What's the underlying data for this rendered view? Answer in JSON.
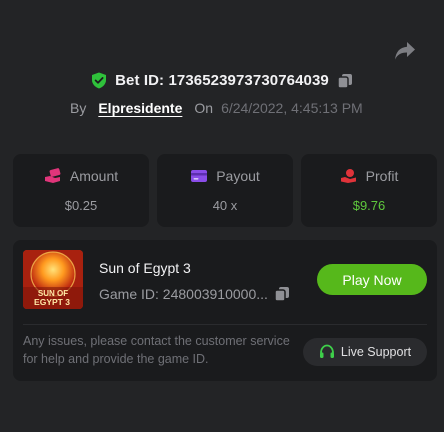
{
  "bet": {
    "id_prefix": "Bet ID:",
    "id_value": "1736523973730764039",
    "by_label": "By",
    "username": "Elpresidente",
    "on_label": "On",
    "date": "6/24/2022, 4:45:13 PM"
  },
  "stats": [
    {
      "label": "Amount",
      "value": "$0.25",
      "icon": "wallet-hand-icon",
      "color": "#e0357a"
    },
    {
      "label": "Payout",
      "value": "40 x",
      "icon": "credit-card-icon",
      "color": "#8a4de8"
    },
    {
      "label": "Profit",
      "value": "$9.76",
      "icon": "hand-coin-icon",
      "color": "#e0333a"
    }
  ],
  "game": {
    "title": "Sun of Egypt 3",
    "id_label": "Game ID: 248003910000...",
    "thumb_text_1": "SUN OF",
    "thumb_text_2": "EGYPT 3",
    "play_label": "Play Now",
    "help_text": "Any issues, please contact the customer service for help and provide the game ID.",
    "support_label": "Live Support"
  },
  "colors": {
    "background": "#232426",
    "card": "#1a1b1d",
    "accent_green": "#56b81b",
    "profit_green": "#5fc93d",
    "shield_green": "#2fc13b"
  }
}
